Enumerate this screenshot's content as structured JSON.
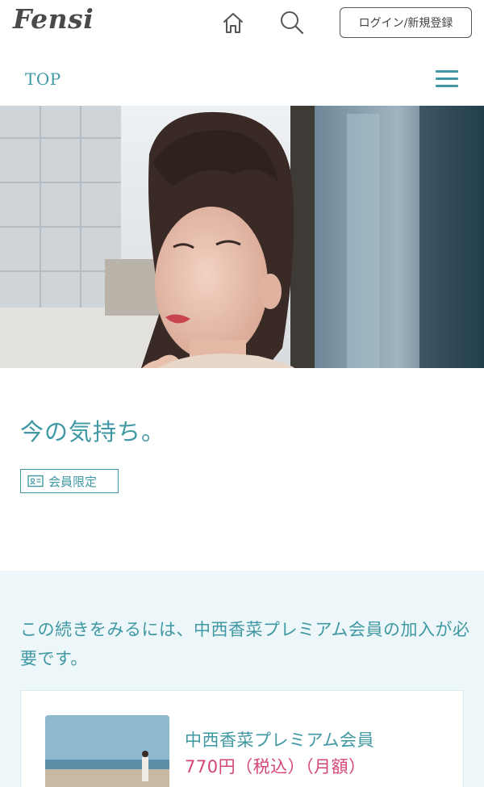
{
  "header": {
    "logo": "Fensi",
    "home_icon": "home-icon",
    "search_icon": "search-icon",
    "login_label": "ログイン/新規登録"
  },
  "subnav": {
    "top_label": "TOP",
    "menu_icon": "hamburger-menu-icon"
  },
  "post": {
    "title": "今の気持ち。",
    "badge_label": "会員限定",
    "badge_icon": "member-card-icon"
  },
  "paywall": {
    "message": "この続きをみるには、中西香菜プレミアム会員の加入が必要です。",
    "plan": {
      "name": "中西香菜プレミアム会員",
      "price": "770円（税込）（月額）"
    }
  },
  "colors": {
    "accent": "#3f98a3",
    "price": "#d6457a",
    "paywall_bg": "#edf7f9"
  }
}
